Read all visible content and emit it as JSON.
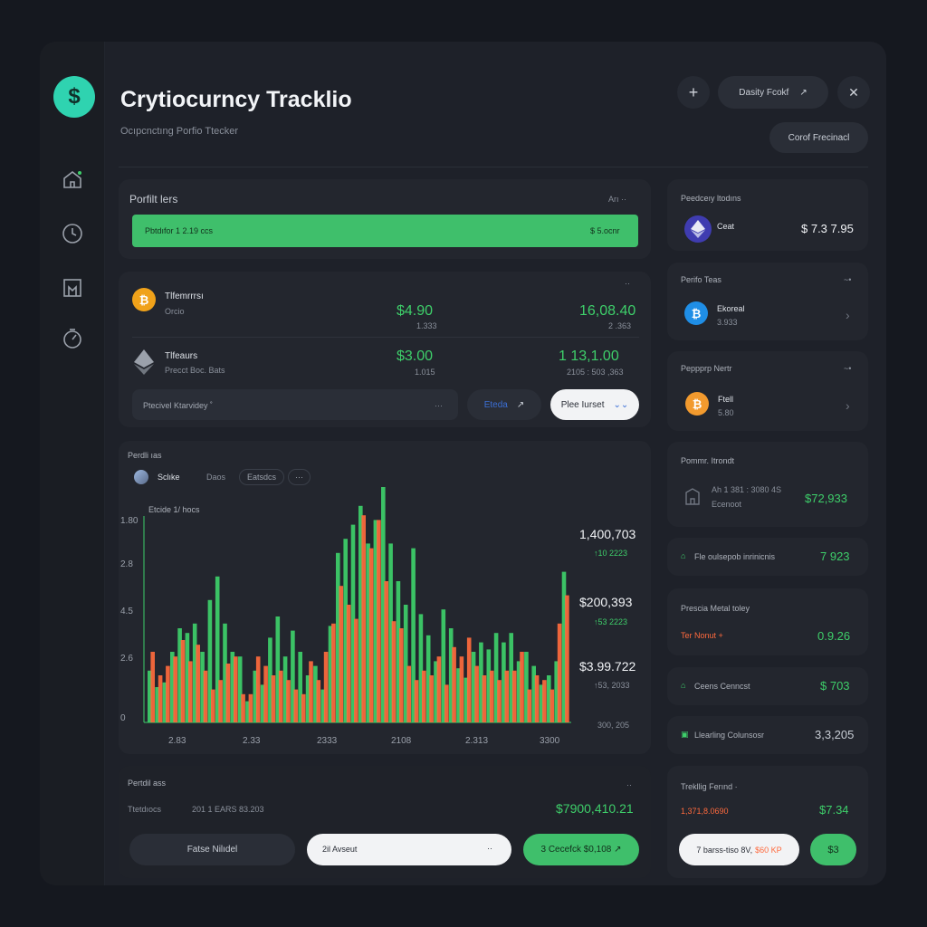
{
  "app": {
    "title": "Crytiocurncy Tracklio",
    "subtitle": "Ocıpcnctıng Porfio Ttecker",
    "logo_glyph": "$"
  },
  "header": {
    "add_label": "+",
    "dropdown_label": "Dasity Fcokf",
    "dropdown_chevron": "↗",
    "close_label": "✕",
    "secondary_button": "Corof Frecinacl"
  },
  "portfolio_bar": {
    "title": "Porfilt lers",
    "more": "Arı ·· ",
    "left_label": "Pbtdıfor 1 2.19 ccs",
    "right_label": "$ 5.ocnr",
    "fill_fraction": 1.0
  },
  "assets": {
    "more": "··",
    "rows": [
      {
        "name": "Tlfemrrrsı",
        "sub": "Orcio",
        "price": "$4.90",
        "price_sub": "1.333",
        "value": "16,08.40",
        "value_sub": "2 .363",
        "icon": "bitcoin-icon"
      },
      {
        "name": "Tlfeaurs",
        "sub": "Precct Boc. Bats",
        "price": "$3.00",
        "price_sub": "1.015",
        "value": "1 13,1.00",
        "value_sub": "2105 : 503 ,363",
        "icon": "ethereum-icon"
      }
    ],
    "search_placeholder": "Ptecivel Ktarvidey ˚",
    "search_more": "···",
    "toggle_label": "Eteda",
    "toggle_chevron": "↗",
    "filter_label": "Plee Iurset",
    "filter_chevron": "⌄⌄"
  },
  "chart_panel": {
    "title": "Perdli ıas",
    "legend_item": "Sclıke",
    "tab1": "Daos",
    "tab2": "Eatsdcs",
    "tab3": "···",
    "chart_label": "Etcide 1/ hocs",
    "callouts": [
      {
        "value": "1,400,703",
        "sub": "↑10 2223"
      },
      {
        "value": "$200,393",
        "sub": "↑53 2223"
      },
      {
        "value": "$3.99.722",
        "sub": "↑53, 2033"
      }
    ],
    "bottom_right": "300, 205"
  },
  "chart_data": {
    "type": "bar",
    "title": "",
    "xlabel": "",
    "ylabel": "",
    "y_ticks": [
      "1.80",
      "2.8",
      "4.5",
      "2.6",
      "0"
    ],
    "x_ticks": [
      "2.83",
      "2.33",
      "2333",
      "2108",
      "2.313",
      "3300"
    ],
    "ylim": [
      0,
      100
    ],
    "series": [
      {
        "color": "#3ecf6a",
        "values": [
          22,
          15,
          17,
          30,
          40,
          38,
          42,
          30,
          52,
          62,
          42,
          30,
          28,
          9,
          22,
          16,
          36,
          45,
          28,
          39,
          30,
          20,
          24,
          14,
          41,
          72,
          78,
          84,
          92,
          76,
          86,
          100,
          76,
          60,
          50,
          74,
          46,
          37,
          26,
          48,
          40,
          23,
          19,
          30,
          34,
          31,
          38,
          34,
          38,
          26,
          30,
          24,
          16,
          20,
          26,
          64
        ]
      },
      {
        "color": "#ff6a3d",
        "values": [
          30,
          20,
          24,
          28,
          35,
          26,
          33,
          22,
          14,
          18,
          25,
          28,
          12,
          12,
          28,
          24,
          20,
          22,
          18,
          14,
          12,
          26,
          18,
          30,
          42,
          58,
          50,
          44,
          88,
          74,
          86,
          60,
          43,
          40,
          24,
          18,
          22,
          20,
          28,
          16,
          32,
          28,
          36,
          24,
          20,
          22,
          18,
          22,
          22,
          30,
          14,
          20,
          18,
          14,
          42,
          54
        ]
      }
    ]
  },
  "bottom_panel": {
    "title": "Pertdil ass",
    "more": "··",
    "row_left": "Ttetdıocs",
    "row_mid": "201   1 EARS 83.203",
    "total": "$7900,410.21",
    "btn_dark": "Fatse Nilıdel",
    "input_value": "2il Avseut",
    "input_more": "··",
    "btn_green": "3 Cecefck $0,108 ↗"
  },
  "right_cards": [
    {
      "title": "Peedceıy ltodıns",
      "coin_name": "Ceat",
      "value": "$ 7.3 7.95",
      "icon": "ethereum-icon",
      "coin_color": "#3f3cb0"
    },
    {
      "title": "Perifo Teas",
      "more": "~•",
      "coin_name": "Ekoreal",
      "coin_sub": "3.933",
      "icon": "bitcoin-blue-icon",
      "coin_color": "#1f8ee6"
    },
    {
      "title": "Peppprp Nertr",
      "more": "~•",
      "coin_name": "Ftell",
      "coin_sub": "5.80",
      "icon": "bitcoin-orange-icon",
      "coin_color": "#f29a2e"
    },
    {
      "title": "Pommr. Itrondt",
      "row_top": "Ah   1 381 : 3080 4S",
      "row_bottom": "Ecenoot",
      "value": "$72,933",
      "icon": "building-icon"
    },
    {
      "label": "Fle oulsepob inrinicnis",
      "value": "7 923"
    },
    {
      "title": "Prescia Metal toley",
      "label": "Ter Nonut +",
      "value": "0.9.26"
    },
    {
      "label": "Ceens Cenncst",
      "value": "$ 703"
    },
    {
      "label": "Llearling Colunsosr",
      "value": "3,3,205"
    },
    {
      "title": "Trekllig Ferınd ·",
      "sub": "1,371,8.0690",
      "value": "$7.34",
      "pill_label": "7 barss-tiso 8V,",
      "pill_accent": "$60 KP",
      "btn_label": "$3"
    }
  ]
}
